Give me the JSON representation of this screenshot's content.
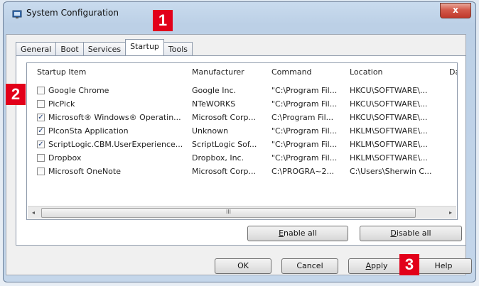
{
  "window": {
    "title": "System Configuration",
    "close_glyph": "x"
  },
  "tabs": [
    {
      "label": "General"
    },
    {
      "label": "Boot"
    },
    {
      "label": "Services"
    },
    {
      "label": "Startup",
      "active": true
    },
    {
      "label": "Tools"
    }
  ],
  "columns": [
    "Startup Item",
    "Manufacturer",
    "Command",
    "Location",
    "Da"
  ],
  "rows": [
    {
      "checked": false,
      "item": "Google Chrome",
      "manufacturer": "Google Inc.",
      "command": "\"C:\\Program Fil...",
      "location": "HKCU\\SOFTWARE\\..."
    },
    {
      "checked": false,
      "item": "PicPick",
      "manufacturer": "NTeWORKS",
      "command": "\"C:\\Program Fil...",
      "location": "HKCU\\SOFTWARE\\..."
    },
    {
      "checked": true,
      "item": "Microsoft® Windows® Operatin...",
      "manufacturer": "Microsoft Corp...",
      "command": "C:\\Program Fil...",
      "location": "HKCU\\SOFTWARE\\..."
    },
    {
      "checked": true,
      "item": "PIconSta Application",
      "manufacturer": "Unknown",
      "command": "\"C:\\Program Fil...",
      "location": "HKLM\\SOFTWARE\\..."
    },
    {
      "checked": true,
      "item": "ScriptLogic.CBM.UserExperience...",
      "manufacturer": "ScriptLogic Sof...",
      "command": "\"C:\\Program Fil...",
      "location": "HKLM\\SOFTWARE\\..."
    },
    {
      "checked": false,
      "item": "Dropbox",
      "manufacturer": "Dropbox, Inc.",
      "command": "\"C:\\Program Fil...",
      "location": "HKLM\\SOFTWARE\\..."
    },
    {
      "checked": false,
      "item": "Microsoft OneNote",
      "manufacturer": "Microsoft Corp...",
      "command": "C:\\PROGRA~2...",
      "location": "C:\\Users\\Sherwin C..."
    }
  ],
  "scrollbar": {
    "left_arrow": "◂",
    "right_arrow": "▸",
    "thumb_grip": "III"
  },
  "buttons": {
    "enable_all": {
      "label": "Enable all",
      "accel": "E",
      "rest": "nable all"
    },
    "disable_all": {
      "label": "Disable all",
      "accel": "D",
      "rest": "isable all"
    },
    "ok": {
      "label": "OK"
    },
    "cancel": {
      "label": "Cancel"
    },
    "apply": {
      "label": "Apply",
      "accel": "A",
      "rest": "pply"
    },
    "help": {
      "label": "Help"
    }
  },
  "markers": [
    "1",
    "2",
    "3"
  ],
  "colors": {
    "marker": "#e2001a",
    "accent": "#1a3c7a"
  }
}
